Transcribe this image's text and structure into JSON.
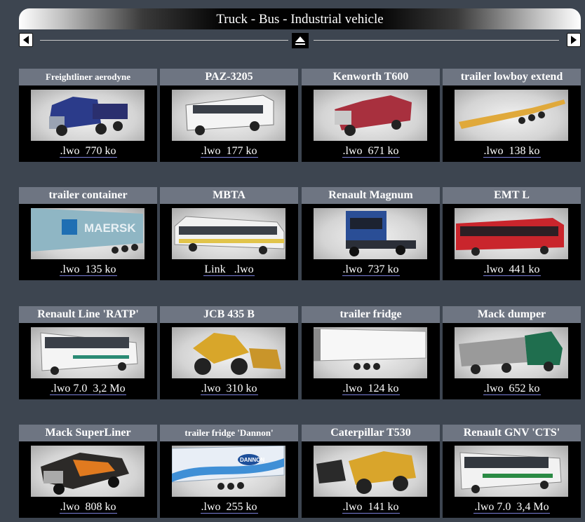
{
  "header": {
    "title": "Truck - Bus - Industrial vehicle"
  },
  "cards": [
    {
      "name": "Freightliner aerodyne",
      "link": ".lwo  770 ko",
      "icon": "truck-blue-icon"
    },
    {
      "name": "PAZ-3205",
      "link": ".lwo  177 ko",
      "icon": "bus-white-icon"
    },
    {
      "name": "Kenworth T600",
      "link": ".lwo  671 ko",
      "icon": "truck-red-icon"
    },
    {
      "name": "trailer lowboy extend",
      "link": ".lwo  138 ko",
      "icon": "trailer-lowboy-icon"
    },
    {
      "name": "trailer container",
      "link": ".lwo  135 ko",
      "icon": "trailer-container-icon"
    },
    {
      "name": "MBTA",
      "link": "Link   .lwo",
      "icon": "trolleybus-icon"
    },
    {
      "name": "Renault Magnum",
      "link": ".lwo  737 ko",
      "icon": "truck-magnum-icon"
    },
    {
      "name": "EMT L",
      "link": ".lwo  441 ko",
      "icon": "bus-red-icon"
    },
    {
      "name": "Renault Line 'RATP'",
      "link": ".lwo 7.0  3,2 Mo",
      "icon": "bus-ratp-icon"
    },
    {
      "name": "JCB 435 B",
      "link": ".lwo  310 ko",
      "icon": "wheel-loader-icon"
    },
    {
      "name": "trailer fridge",
      "link": ".lwo  124 ko",
      "icon": "trailer-fridge-icon"
    },
    {
      "name": "Mack dumper",
      "link": ".lwo  652 ko",
      "icon": "dump-truck-icon"
    },
    {
      "name": "Mack SuperLiner",
      "link": ".lwo  808 ko",
      "icon": "truck-flames-icon"
    },
    {
      "name": "trailer fridge 'Dannon'",
      "link": ".lwo  255 ko",
      "icon": "trailer-dannon-icon"
    },
    {
      "name": "Caterpillar T530",
      "link": ".lwo  141 ko",
      "icon": "wheel-loader-icon"
    },
    {
      "name": "Renault GNV  'CTS'",
      "link": ".lwo 7.0  3,4 Mo",
      "icon": "bus-cts-icon"
    }
  ],
  "thumb_labels": {
    "maersk": "MAERSK",
    "dannon": "DANNON"
  },
  "colors": {
    "background": "#3d4550",
    "card_header": "#6e7582",
    "link_underline": "#7a7fd9"
  }
}
